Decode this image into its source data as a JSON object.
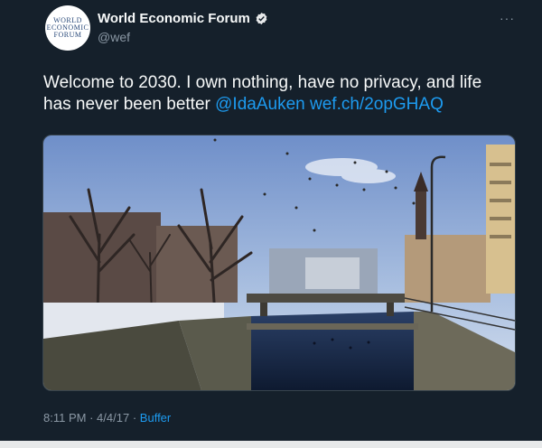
{
  "tweet": {
    "avatar_lines": [
      "WORLD",
      "ECONOMIC",
      "FORUM"
    ],
    "display_name": "World Economic Forum",
    "handle": "@wef",
    "more_label": "···",
    "text": "Welcome to 2030. I own nothing, have no privacy, and life has never been better ",
    "mention": "@IdaAuken",
    "link": "wef.ch/2opGHAQ",
    "time": "8:11 PM",
    "date": "4/4/17",
    "separator": "·",
    "source": "Buffer"
  },
  "colors": {
    "background": "#15202b",
    "text": "#f7f9f9",
    "muted": "#8b98a5",
    "link": "#1d9bf0",
    "verified": "#1d9bf0"
  },
  "icons": {
    "verified": "verified-badge-icon",
    "more": "more-options-icon"
  },
  "media": {
    "description_type": "photo"
  }
}
